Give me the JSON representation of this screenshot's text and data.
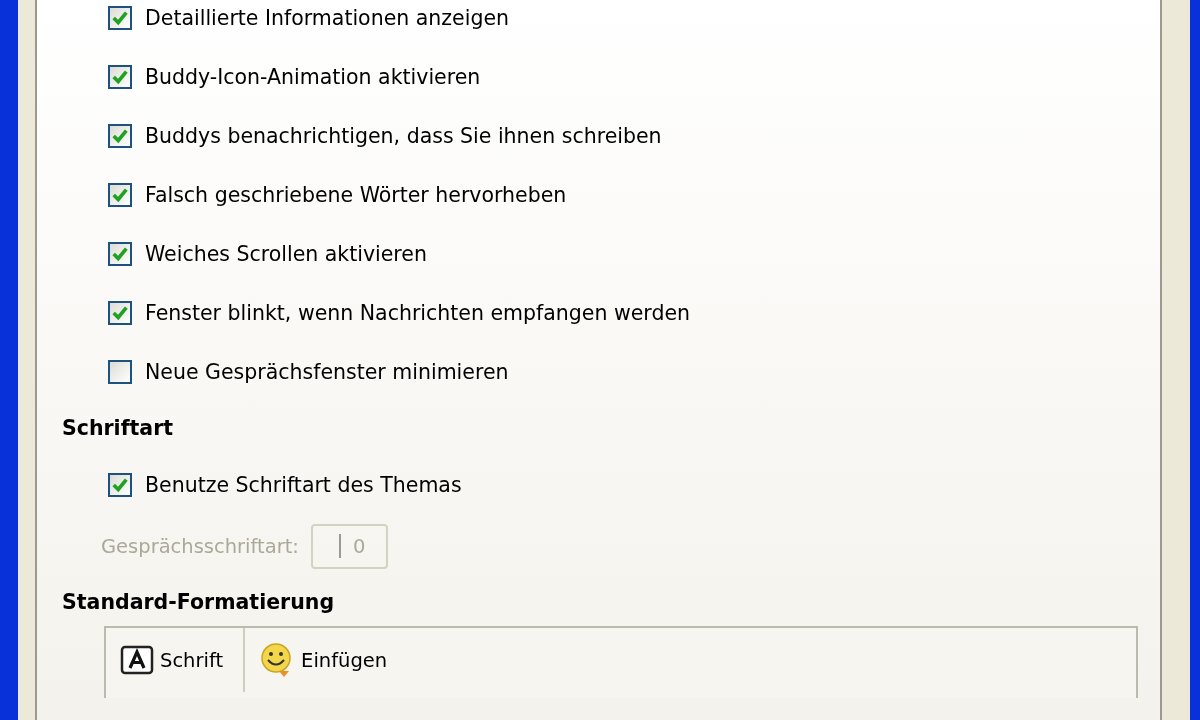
{
  "sections": [
    {
      "options": [
        {
          "label": "Detaillierte Informationen anzeigen",
          "checked": true
        },
        {
          "label": "Buddy-Icon-Animation aktivieren",
          "checked": true
        },
        {
          "label": "Buddys benachrichtigen, dass Sie ihnen schreiben",
          "checked": true
        },
        {
          "label": "Falsch geschriebene Wörter hervorheben",
          "checked": true
        },
        {
          "label": "Weiches Scrollen aktivieren",
          "checked": true
        },
        {
          "label": "Fenster blinkt, wenn Nachrichten empfangen werden",
          "checked": true
        },
        {
          "label": "Neue Gesprächsfenster minimieren",
          "checked": false
        }
      ]
    },
    {
      "heading": "Schriftart",
      "options": [
        {
          "label": "Benutze Schriftart des Themas",
          "checked": true
        }
      ],
      "font_field": {
        "label": "Gesprächsschriftart:",
        "value": "0",
        "disabled": true
      }
    },
    {
      "heading": "Standard-Formatierung",
      "toolbar": [
        {
          "kind": "font",
          "label": "Schrift"
        },
        {
          "kind": "smiley",
          "label": "Einfügen"
        }
      ]
    }
  ]
}
